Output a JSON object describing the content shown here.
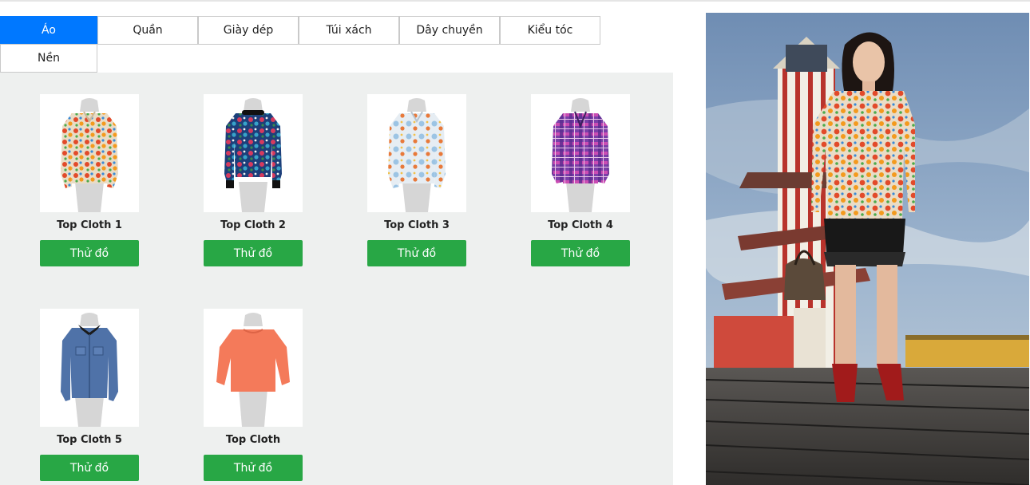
{
  "tabs": [
    {
      "label": "Áo",
      "active": true
    },
    {
      "label": "Quần",
      "active": false
    },
    {
      "label": "Giày dép",
      "active": false
    },
    {
      "label": "Túi xách",
      "active": false
    },
    {
      "label": "Dây chuyền",
      "active": false
    },
    {
      "label": "Kiểu tóc",
      "active": false
    },
    {
      "label": "Nền",
      "active": false
    }
  ],
  "products": [
    {
      "name": "Top Cloth 1",
      "button": "Thử đồ",
      "icon": "floral-shirt-icon"
    },
    {
      "name": "Top Cloth 2",
      "button": "Thử đồ",
      "icon": "floral-blouse-icon"
    },
    {
      "name": "Top Cloth 3",
      "button": "Thử đồ",
      "icon": "watercolor-shirt-icon"
    },
    {
      "name": "Top Cloth 4",
      "button": "Thử đồ",
      "icon": "plaid-shirt-icon"
    },
    {
      "name": "Top Cloth 5",
      "button": "Thử đồ",
      "icon": "denim-shirt-icon"
    },
    {
      "name": "Top Cloth",
      "button": "Thử đồ",
      "icon": "coral-blouse-icon"
    }
  ],
  "colors": {
    "tab_active": "#0078ff",
    "button": "#28a745",
    "grid_background": "#eef0ef"
  },
  "preview": {
    "icon": "model-preview-image"
  }
}
